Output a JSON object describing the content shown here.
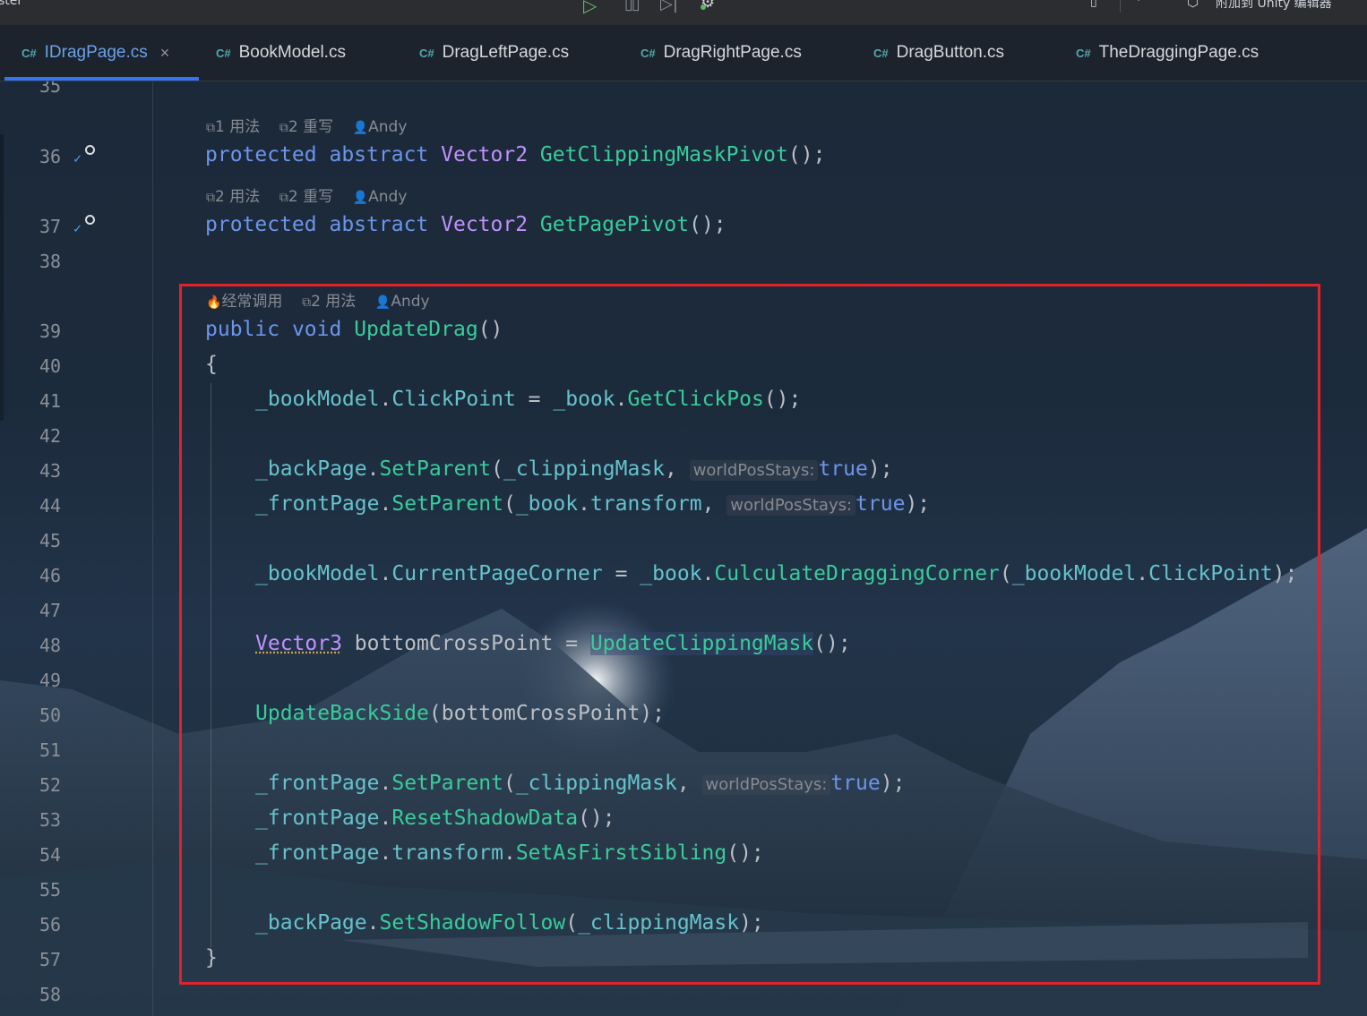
{
  "toolbar": {
    "left_text": "ster",
    "run_icon": "▷",
    "pause_icon": "▯▯",
    "step_icon": "▷|",
    "device_icon": "▯",
    "attach_label": "附加到 Unity 编辑器"
  },
  "tabs": [
    {
      "lang": "C#",
      "name": "IDragPage.cs",
      "active": true,
      "close": "×"
    },
    {
      "lang": "C#",
      "name": "BookModel.cs"
    },
    {
      "lang": "C#",
      "name": "DragLeftPage.cs"
    },
    {
      "lang": "C#",
      "name": "DragRightPage.cs"
    },
    {
      "lang": "C#",
      "name": "DragButton.cs"
    },
    {
      "lang": "C#",
      "name": "TheDraggingPage.cs"
    }
  ],
  "line_numbers": [
    "35",
    "36",
    "37",
    "38",
    "39",
    "40",
    "41",
    "42",
    "43",
    "44",
    "45",
    "46",
    "47",
    "48",
    "49",
    "50",
    "51",
    "52",
    "53",
    "54",
    "55",
    "56",
    "57",
    "58"
  ],
  "hints": {
    "h36": {
      "usages": "1 用法",
      "overrides": "2 重写",
      "author": "Andy"
    },
    "h37": {
      "usages": "2 用法",
      "overrides": "2 重写",
      "author": "Andy"
    },
    "h39": {
      "frequent": "经常调用",
      "usages": "2 用法",
      "author": "Andy"
    }
  },
  "param_hint": "worldPosStays:",
  "code": {
    "protected": "protected",
    "abstract": "abstract",
    "vector2": "Vector2",
    "getClippingMaskPivot": "GetClippingMaskPivot",
    "getPagePivot": "GetPagePivot",
    "public": "public",
    "void": "void",
    "updateDrag": "UpdateDrag",
    "bookModel": "_bookModel",
    "clickPoint": "ClickPoint",
    "book": "_book",
    "getClickPos": "GetClickPos",
    "backPage": "_backPage",
    "frontPage": "_frontPage",
    "setParent": "SetParent",
    "clippingMask": "_clippingMask",
    "transform": "transform",
    "true_kw": "true",
    "currentPageCorner": "CurrentPageCorner",
    "culculateDraggingCorner": "CulculateDraggingCorner",
    "vector3": "Vector3",
    "bottomCrossPoint": "bottomCrossPoint",
    "updateClippingMask": "UpdateClippingMask",
    "updateBackSide": "UpdateBackSide",
    "resetShadowData": "ResetShadowData",
    "setAsFirstSibling": "SetAsFirstSibling",
    "setShadowFollow": "SetShadowFollow",
    "open_brace": "{",
    "close_brace": "}"
  }
}
